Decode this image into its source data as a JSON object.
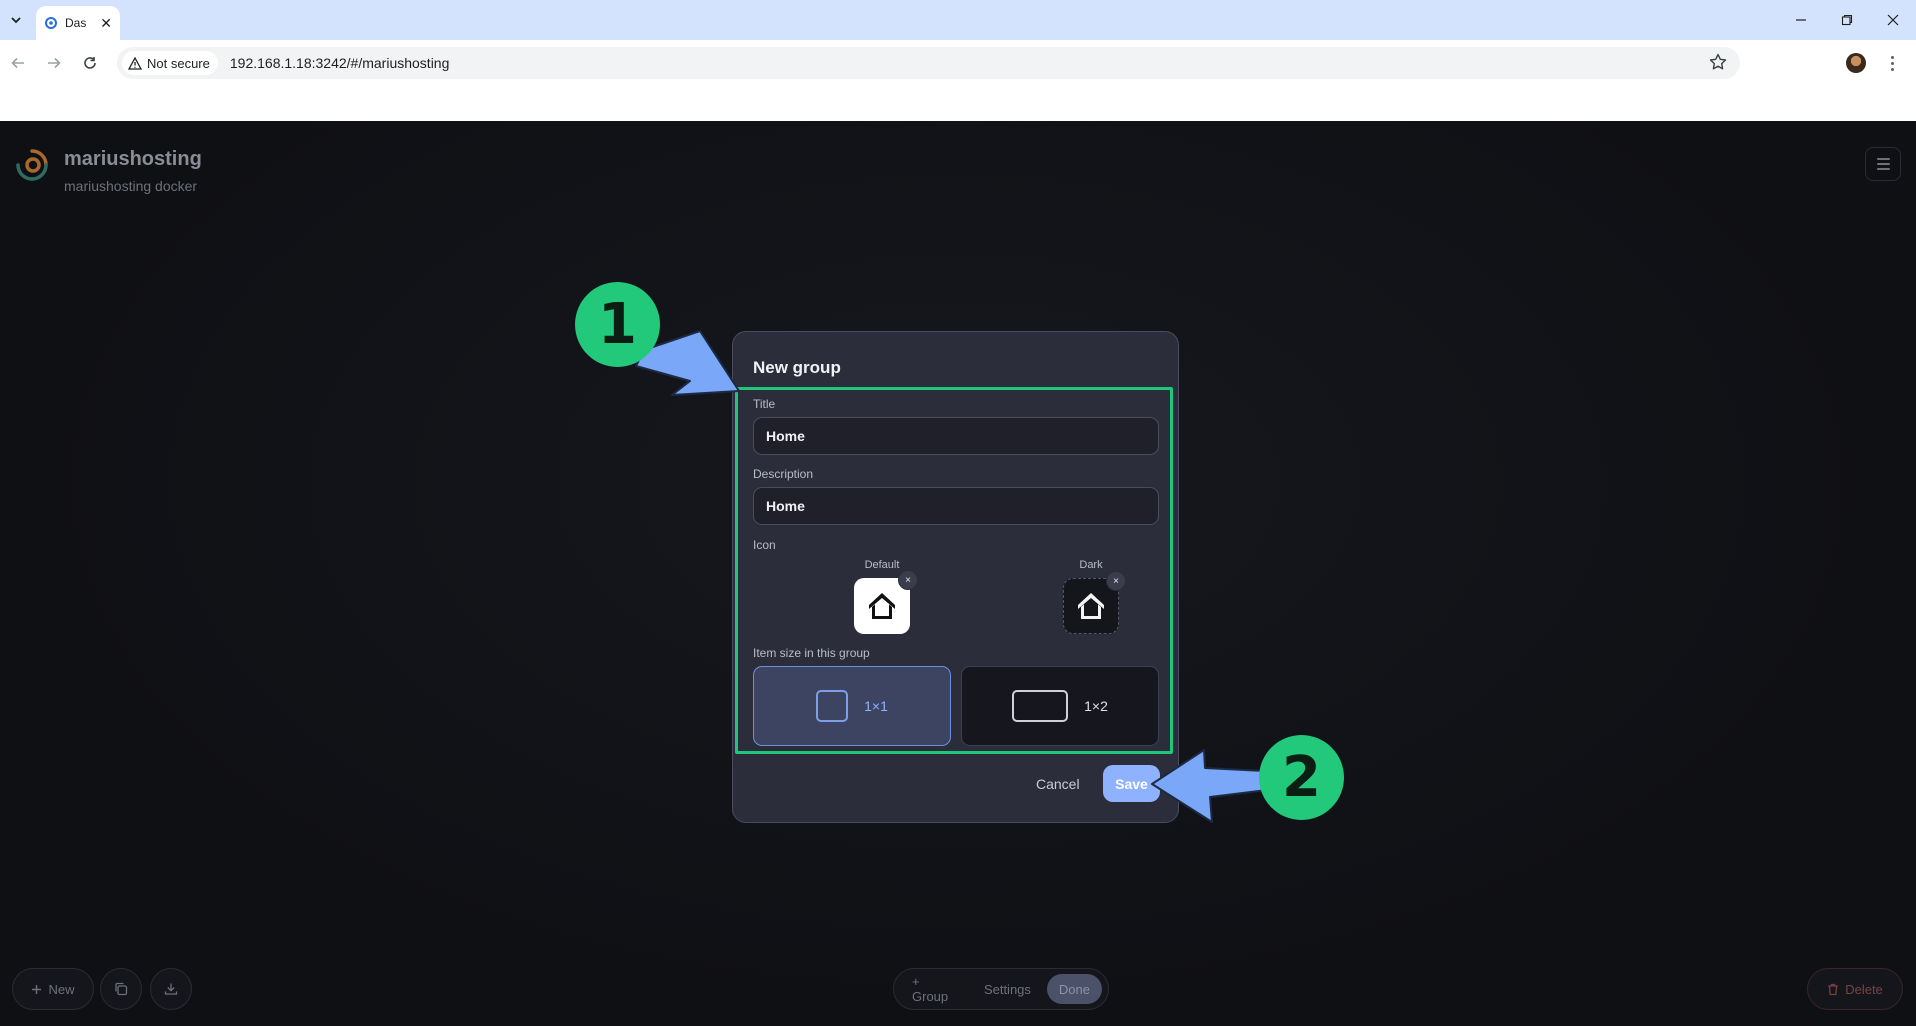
{
  "browser": {
    "tab_title": "Das",
    "tab_close": "✕",
    "security_label": "Not secure",
    "url": "192.168.1.18:3242/#/mariushosting"
  },
  "header": {
    "title": "mariushosting",
    "subtitle": "mariushosting docker"
  },
  "dialog": {
    "title": "New group",
    "title_label": "Title",
    "title_value": "Home",
    "description_label": "Description",
    "description_value": "Home",
    "icon_label": "Icon",
    "icon_default_label": "Default",
    "icon_dark_label": "Dark",
    "icon_remove": "×",
    "size_label": "Item size in this group",
    "size_options": [
      {
        "label": "1×1",
        "selected": true
      },
      {
        "label": "1×2",
        "selected": false
      }
    ],
    "cancel_label": "Cancel",
    "save_label": "Save"
  },
  "bottom_bar": {
    "new_label": "New",
    "group_label": "+ Group",
    "settings_label": "Settings",
    "done_label": "Done",
    "delete_label": "Delete"
  },
  "annotations": {
    "step_1": "1",
    "step_2": "2"
  },
  "colors": {
    "accent": "#8fb2ff",
    "highlight": "#1fc77c",
    "arrow": "#7aa7f7"
  }
}
